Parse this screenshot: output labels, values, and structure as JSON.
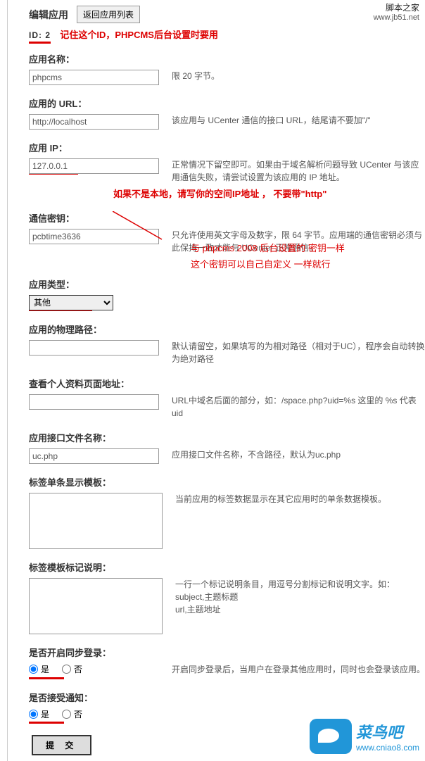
{
  "header": {
    "title": "编辑应用",
    "back": "返回应用列表"
  },
  "topRight": {
    "name": "脚本之家",
    "url": "www.jb51.net"
  },
  "idRow": {
    "label": "ID: 2",
    "note": "记住这个ID，PHPCMS后台设置时要用"
  },
  "fields": {
    "appName": {
      "label": "应用名称：",
      "value": "phpcms",
      "help": "限 20 字节。"
    },
    "appUrl": {
      "label": "应用的 URL：",
      "value": "http://localhost",
      "help": "该应用与 UCenter 通信的接口 URL，结尾请不要加\"/\""
    },
    "appIp": {
      "label": "应用 IP：",
      "value": "127.0.0.1",
      "help": "正常情况下留空即可。如果由于域名解析问题导致 UCenter 与该应用通信失败，请尝试设置为该应用的 IP 地址。"
    },
    "ipNote": "如果不是本地，请写你的空间IP地址  ，   不要带\"http\"",
    "secret": {
      "label": "通信密钥：",
      "value": "pcbtime3636",
      "help": "只允许使用英文字母及数字，限 64 字节。应用端的通信密钥必须与此保持一致才能与 UCenter 正常通信。"
    },
    "secretNote1": "与  phpcms 2008   后台设置的   密钥一样",
    "secretNote2": "这个密钥可以自己自定义   一样就行",
    "appType": {
      "label": "应用类型：",
      "value": "其他"
    },
    "phyPath": {
      "label": "应用的物理路径：",
      "value": "",
      "help": "默认请留空，如果填写的为相对路径（相对于UC），程序会自动转换为绝对路径"
    },
    "profile": {
      "label": "查看个人资料页面地址：",
      "value": "",
      "help": "URL中域名后面的部分，如：/space.php?uid=%s 这里的 %s 代表uid"
    },
    "apiFile": {
      "label": "应用接口文件名称：",
      "value": "uc.php",
      "help": "应用接口文件名称，不含路径，默认为uc.php"
    },
    "tagTpl": {
      "label": "标签单条显示模板：",
      "value": "",
      "help": "当前应用的标签数据显示在其它应用时的单条数据模板。"
    },
    "tagDesc": {
      "label": "标签模板标记说明：",
      "value": "",
      "help": "一行一个标记说明条目，用逗号分割标记和说明文字。如：\nsubject,主题标题\nurl,主题地址"
    },
    "syncLogin": {
      "label": "是否开启同步登录：",
      "yes": "是",
      "no": "否",
      "help": "开启同步登录后，当用户在登录其他应用时，同时也会登录该应用。"
    },
    "notify": {
      "label": "是否接受通知：",
      "yes": "是",
      "no": "否"
    }
  },
  "submit": "提 交",
  "logo": {
    "cn": "菜鸟吧",
    "url": "www.cniao8.com"
  }
}
